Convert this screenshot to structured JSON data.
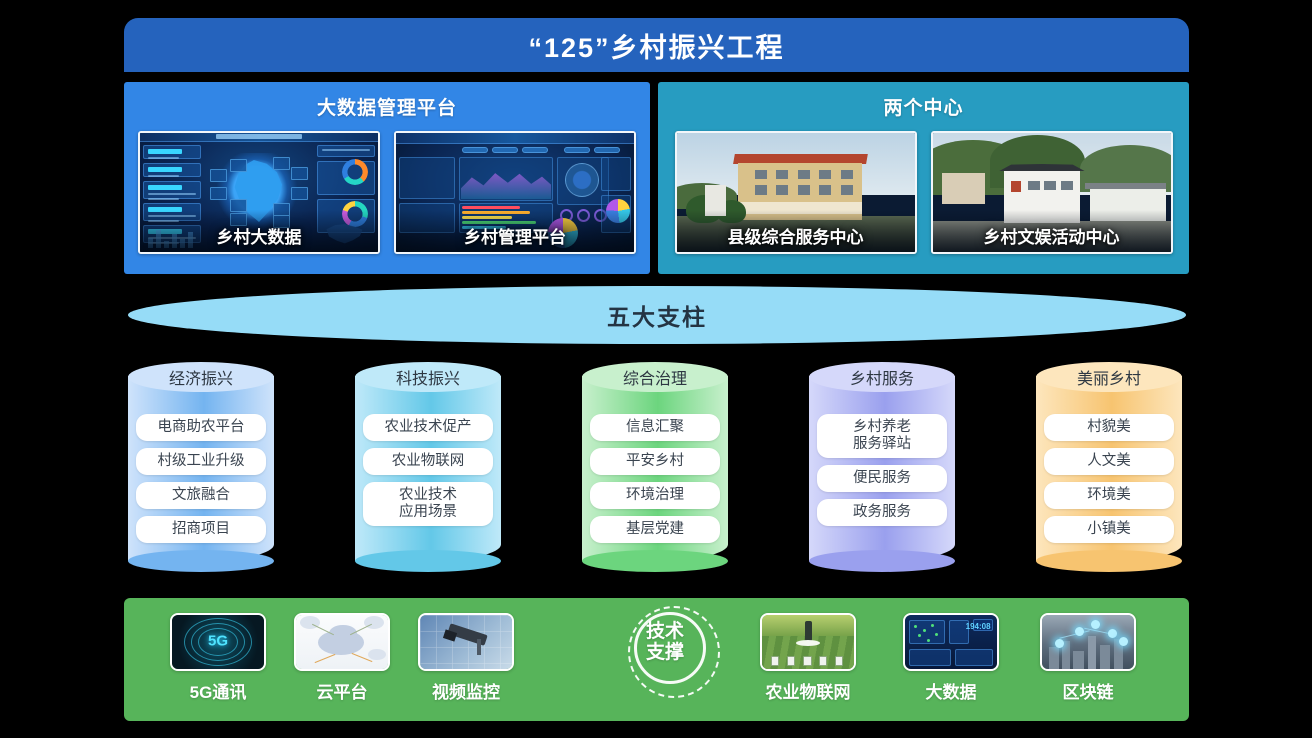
{
  "header": {
    "title": "“125”乡村振兴工程"
  },
  "platforms": {
    "left": {
      "title": "大数据管理平台",
      "cards": [
        {
          "caption": "乡村大数据",
          "icon": "dashboard-map-thumbnail"
        },
        {
          "caption": "乡村管理平台",
          "icon": "dashboard-charts-thumbnail"
        }
      ]
    },
    "right": {
      "title": "两个中心",
      "cards": [
        {
          "caption": "县级综合服务中心",
          "icon": "service-center-photo"
        },
        {
          "caption": "乡村文娱活动中心",
          "icon": "culture-center-photo"
        }
      ]
    }
  },
  "pillars_banner": {
    "label": "五大支柱"
  },
  "pillars": [
    {
      "title": "经济振兴",
      "color_top": "#cfe3fb",
      "color_body": "#74b4f0",
      "items": [
        "电商助农平台",
        "村级工业升级",
        "文旅融合",
        "招商项目"
      ]
    },
    {
      "title": "科技振兴",
      "color_top": "#bfe9f9",
      "color_body": "#63c8e8",
      "items": [
        "农业技术促产",
        "农业物联网",
        "农业技术\n应用场景"
      ]
    },
    {
      "title": "综合治理",
      "color_top": "#c8f0cd",
      "color_body": "#6cd57e",
      "items": [
        "信息汇聚",
        "平安乡村",
        "环境治理",
        "基层党建"
      ]
    },
    {
      "title": "乡村服务",
      "color_top": "#d5d8fa",
      "color_body": "#9aa0ee",
      "items": [
        "乡村养老\n服务驿站",
        "便民服务",
        "政务服务"
      ]
    },
    {
      "title": "美丽乡村",
      "color_top": "#fde6bd",
      "color_body": "#f7c470",
      "items": [
        "村貌美",
        "人文美",
        "环境美",
        "小镇美"
      ]
    }
  ],
  "tech_support": {
    "badge_line1": "技术",
    "badge_line2": "支撑",
    "items": [
      {
        "label": "5G通讯",
        "icon": "5g-network-icon"
      },
      {
        "label": "云平台",
        "icon": "cloud-platform-icon"
      },
      {
        "label": "视频监控",
        "icon": "video-surveillance-icon"
      },
      {
        "label": "农业物联网",
        "icon": "agriculture-iot-icon"
      },
      {
        "label": "大数据",
        "icon": "big-data-icon"
      },
      {
        "label": "区块链",
        "icon": "blockchain-icon"
      }
    ]
  },
  "colors": {
    "title_bar": "#2563bd",
    "platform_left": "#3286e6",
    "platform_right": "#279cc1",
    "pillars_ellipse": "#96dcf7",
    "tech_bar": "#57b45a",
    "background": "#000000"
  }
}
